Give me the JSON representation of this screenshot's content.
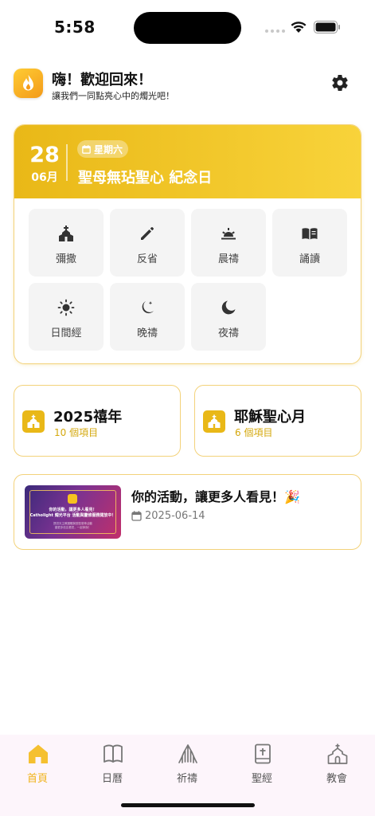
{
  "status_bar": {
    "time": "5:58"
  },
  "header": {
    "greeting": "嗨！歡迎回來！",
    "subtitle": "讓我們一同點亮心中的燭光吧！",
    "settings_icon": "gear-icon"
  },
  "feast": {
    "day": "28",
    "month": "06月",
    "weekday": "星期六",
    "title": "聖母無玷聖心 紀念日"
  },
  "prayers": [
    {
      "label": "彌撒",
      "icon": "church-icon"
    },
    {
      "label": "反省",
      "icon": "pencil-icon"
    },
    {
      "label": "晨禱",
      "icon": "sunrise-icon"
    },
    {
      "label": "誦讀",
      "icon": "book-icon"
    },
    {
      "label": "日間經",
      "icon": "sun-icon"
    },
    {
      "label": "晚禱",
      "icon": "moon-stars-icon"
    },
    {
      "label": "夜禱",
      "icon": "moon-icon"
    }
  ],
  "topics": [
    {
      "title": "2025禧年",
      "count": "10 個項目"
    },
    {
      "title": "耶穌聖心月",
      "count": "6 個項目"
    }
  ],
  "event": {
    "title": "你的活動，讓更多人看見！🎉",
    "date": "2025-06-14",
    "thumb_line1": "你的活動，讓更多人看見！",
    "thumb_line2": "Catholight 燭光平台 活動與靈修服務開放中！",
    "thumb_line3": "提供天主教團體與堂區發佈活動",
    "thumb_line4": "讓更多信友看見，一起參與！"
  },
  "tabs": [
    {
      "label": "首頁",
      "icon": "home-icon",
      "active": true
    },
    {
      "label": "日曆",
      "icon": "calendar-book-icon",
      "active": false
    },
    {
      "label": "祈禱",
      "icon": "praying-hands-icon",
      "active": false
    },
    {
      "label": "聖經",
      "icon": "bible-icon",
      "active": false
    },
    {
      "label": "教會",
      "icon": "church-icon",
      "active": false
    }
  ],
  "colors": {
    "accent": "#f0b31c",
    "card_border": "#f3d27a",
    "header_gradient_start": "#e9b817",
    "header_gradient_end": "#f8d33a"
  }
}
